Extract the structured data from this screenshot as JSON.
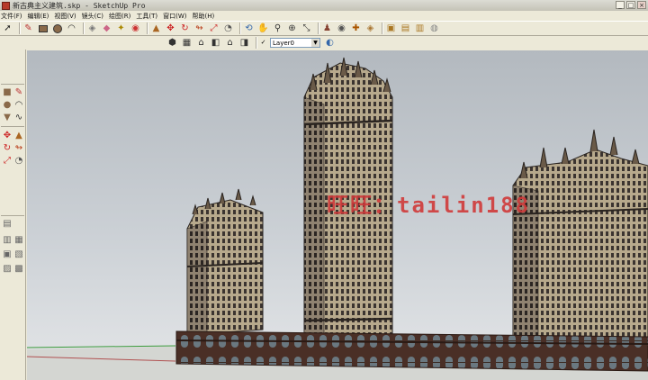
{
  "window": {
    "title": "新古典主义建筑.skp - SketchUp Pro",
    "minimize": "_",
    "maximize": "□",
    "close": "×"
  },
  "menu": [
    {
      "name": "file",
      "label": "文件(F)"
    },
    {
      "name": "edit",
      "label": "编辑(E)"
    },
    {
      "name": "view",
      "label": "视图(V)"
    },
    {
      "name": "camera",
      "label": "镜头(C)"
    },
    {
      "name": "draw",
      "label": "绘图(R)"
    },
    {
      "name": "tools",
      "label": "工具(T)"
    },
    {
      "name": "window",
      "label": "窗口(W)"
    },
    {
      "name": "help",
      "label": "帮助(H)"
    }
  ],
  "layers": {
    "current": "Layer0",
    "visible_check": "✓"
  },
  "watermark": "旺旺：tailin188",
  "colors": {
    "chrome": "#ece9d8",
    "sky_top": "#b3b9bf",
    "sky_bottom": "#e2e4e6",
    "facade": "#b9ab8e",
    "facade_dark": "#3a302a",
    "podium": "#4a2f26",
    "watermark": "#d03a3a",
    "axis_green": "#3a9a3a",
    "axis_red": "#b05050"
  },
  "icons": {
    "select": "select-arrow-icon",
    "eraser": "eraser-icon",
    "paint": "paint-bucket-icon",
    "orbit": "orbit-icon",
    "pan": "pan-hand-icon",
    "zoom": "zoom-icon",
    "zoom_extents": "zoom-extents-icon",
    "views": [
      "iso-view-icon",
      "top-view-icon",
      "front-view-icon",
      "right-view-icon",
      "back-view-icon",
      "left-view-icon"
    ]
  }
}
